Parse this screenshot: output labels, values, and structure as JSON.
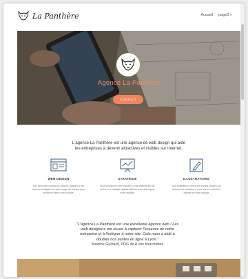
{
  "header": {
    "logo_text": "La Panthère",
    "nav": [
      "Accueil",
      "page3 »"
    ]
  },
  "hero": {
    "title": "Agence La Panthère",
    "button_label": "CONTACT"
  },
  "intro": {
    "line1": "L'agence La Panthère est une agence de web design qui aide",
    "line2": "les entreprises à devenir attractives et visibles sur Internet."
  },
  "services": [
    {
      "icon": "web-design-icon",
      "title": "WEB DESIGN",
      "desc": "Nos sites sont conçus sur-mesure, adaptés à vos besoins et alignés sur votre image de marque pour mettre en valeur votre activité."
    },
    {
      "icon": "strategy-icon",
      "title": "STRATÉGIE",
      "desc": "Nous analysons votre marché et vos objectifs afin de définir une stratégie digitale efficace pour développer votre visibilité."
    },
    {
      "icon": "illustrations-icon",
      "title": "ILLUSTRATIONS",
      "desc": "Nos illustrateurs créent des visuels uniques qui donnent du caractère à votre site et renforcent l'identité de votre marque."
    }
  ],
  "testimonial": {
    "quote_lines": [
      "\"L'agence La Panthère est une excellente agence web ! Les",
      "web designers ont réussi à capturer l'essence de notre",
      "entreprise et à l'intégrer à notre site. Cela nous a aidé à",
      "doubler nos ventes en ligne à Lyon.\""
    ],
    "author": "Maxime Guibard, PDG de A vos fourchettes"
  },
  "colors": {
    "accent": "#f0845c",
    "hero_title": "#f28c64",
    "text": "#333333"
  }
}
